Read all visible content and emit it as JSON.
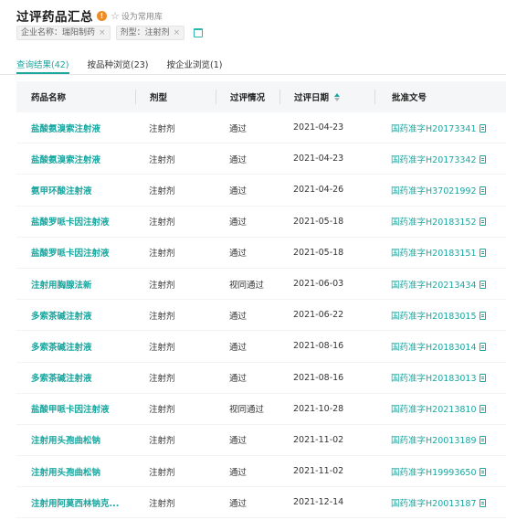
{
  "header": {
    "title": "过评药品汇总",
    "info_glyph": "!",
    "star_glyph": "☆",
    "favorite_label": "设为常用库"
  },
  "filters": [
    {
      "label": "企业名称：瑞阳制药"
    },
    {
      "label": "剂型：注射剂"
    }
  ],
  "tabs": [
    {
      "label": "查询结果(42)",
      "active": true
    },
    {
      "label": "按品种浏览(23)",
      "active": false
    },
    {
      "label": "按企业浏览(1)",
      "active": false
    }
  ],
  "table": {
    "columns": [
      "药品名称",
      "剂型",
      "过评情况",
      "过评日期",
      "批准文号"
    ],
    "rows": [
      {
        "name": "盐酸氨溴索注射液",
        "form": "注射剂",
        "status": "通过",
        "date": "2021-04-23",
        "approval": "国药准字H20173341"
      },
      {
        "name": "盐酸氨溴索注射液",
        "form": "注射剂",
        "status": "通过",
        "date": "2021-04-23",
        "approval": "国药准字H20173342"
      },
      {
        "name": "氨甲环酸注射液",
        "form": "注射剂",
        "status": "通过",
        "date": "2021-04-26",
        "approval": "国药准字H37021992"
      },
      {
        "name": "盐酸罗哌卡因注射液",
        "form": "注射剂",
        "status": "通过",
        "date": "2021-05-18",
        "approval": "国药准字H20183152"
      },
      {
        "name": "盐酸罗哌卡因注射液",
        "form": "注射剂",
        "status": "通过",
        "date": "2021-05-18",
        "approval": "国药准字H20183151"
      },
      {
        "name": "注射用胸腺法新",
        "form": "注射剂",
        "status": "视同通过",
        "date": "2021-06-03",
        "approval": "国药准字H20213434"
      },
      {
        "name": "多索茶碱注射液",
        "form": "注射剂",
        "status": "通过",
        "date": "2021-06-22",
        "approval": "国药准字H20183015"
      },
      {
        "name": "多索茶碱注射液",
        "form": "注射剂",
        "status": "通过",
        "date": "2021-08-16",
        "approval": "国药准字H20183014"
      },
      {
        "name": "多索茶碱注射液",
        "form": "注射剂",
        "status": "通过",
        "date": "2021-08-16",
        "approval": "国药准字H20183013"
      },
      {
        "name": "盐酸甲哌卡因注射液",
        "form": "注射剂",
        "status": "视同通过",
        "date": "2021-10-28",
        "approval": "国药准字H20213810"
      },
      {
        "name": "注射用头孢曲松钠",
        "form": "注射剂",
        "status": "通过",
        "date": "2021-11-02",
        "approval": "国药准字H20013189"
      },
      {
        "name": "注射用头孢曲松钠",
        "form": "注射剂",
        "status": "通过",
        "date": "2021-11-02",
        "approval": "国药准字H19993650"
      },
      {
        "name": "注射用阿莫西林钠克...",
        "form": "注射剂",
        "status": "通过",
        "date": "2021-12-14",
        "approval": "国药准字H20013187"
      }
    ]
  },
  "colors": {
    "accent": "#1aa7a0",
    "info_badge": "#f08a24",
    "header_bg": "#f5f6f7"
  }
}
